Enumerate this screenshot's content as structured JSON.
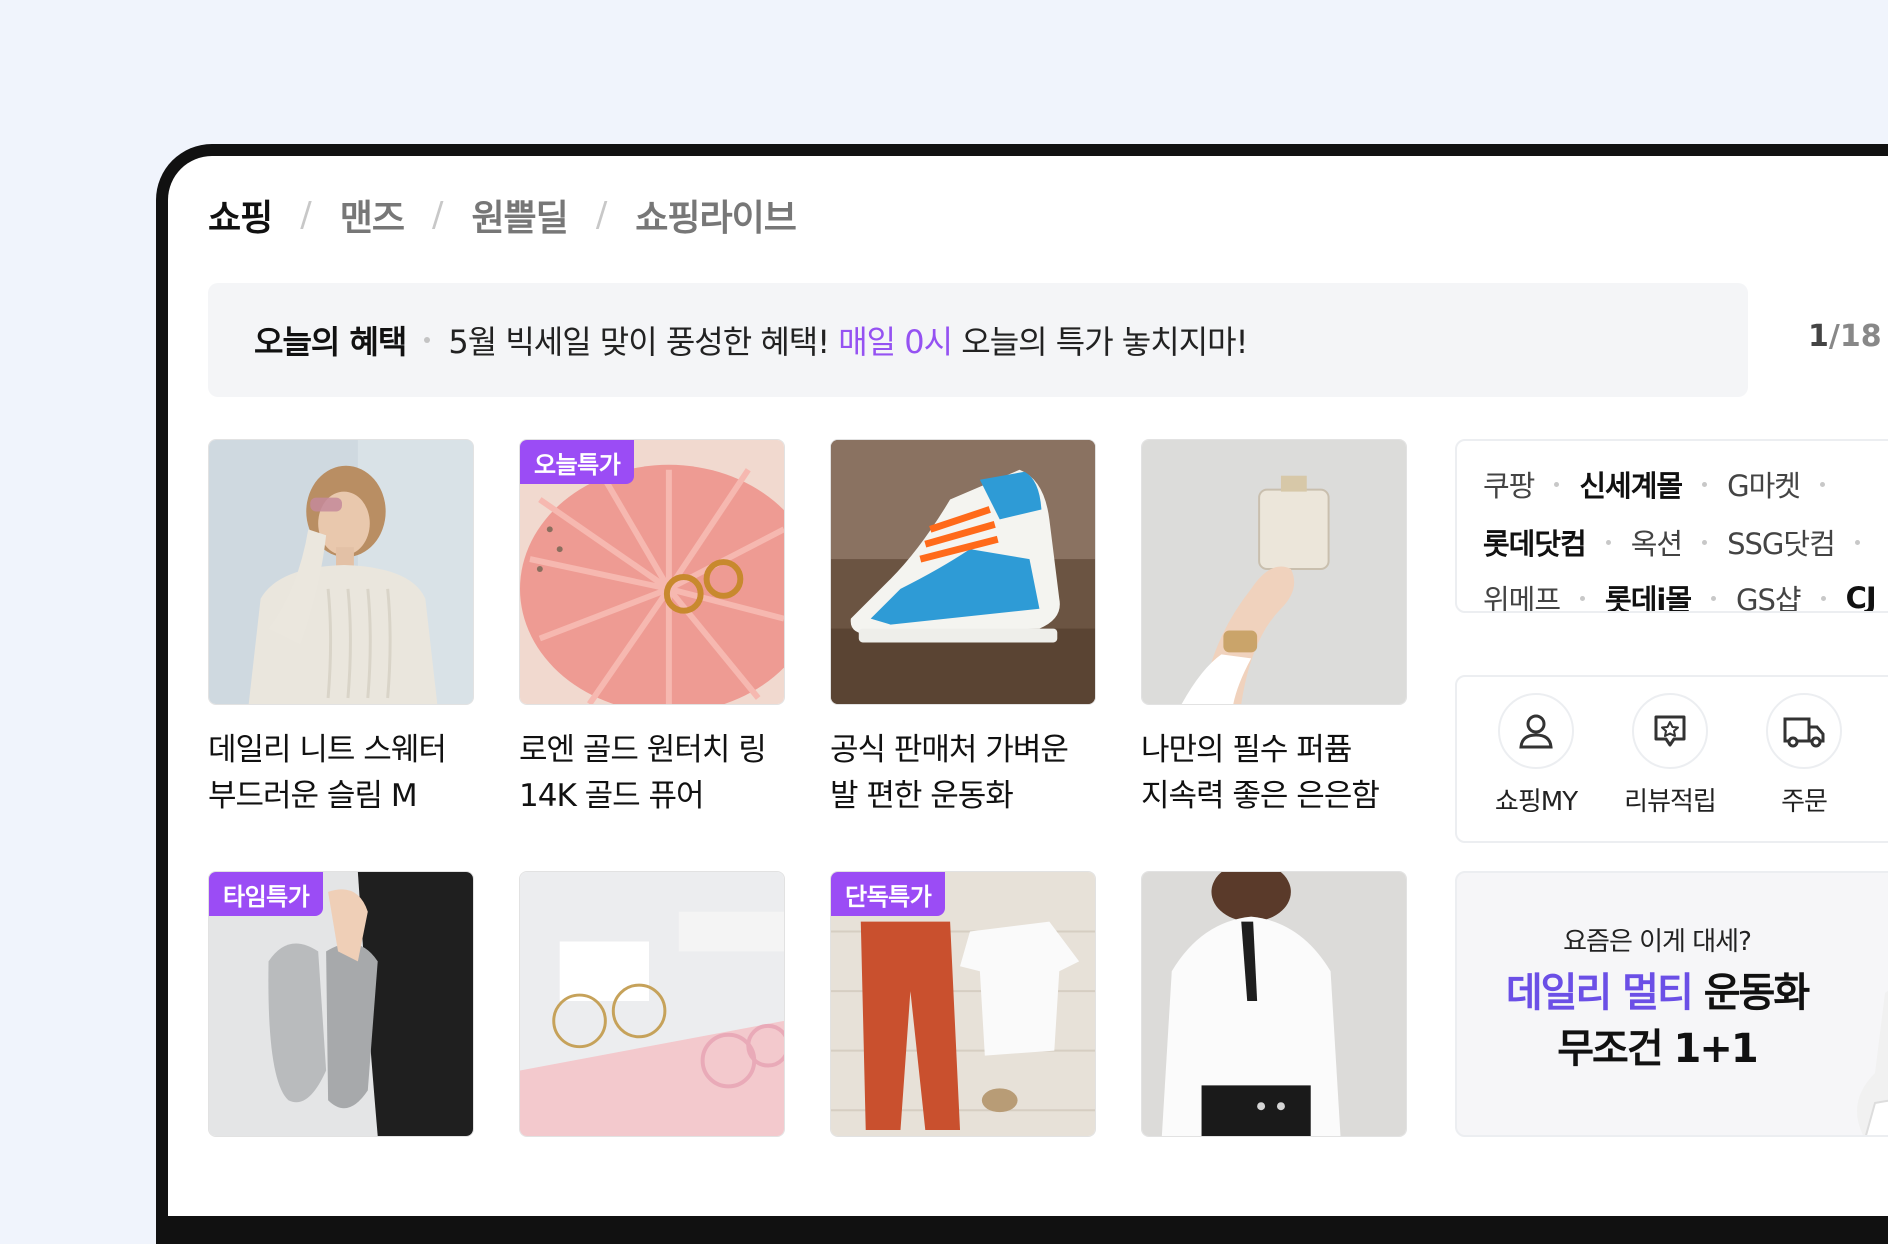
{
  "breadcrumb": [
    {
      "label": "쇼핑",
      "active": true
    },
    {
      "label": "맨즈",
      "active": false
    },
    {
      "label": "원쁠딜",
      "active": false
    },
    {
      "label": "쇼핑라이브",
      "active": false
    }
  ],
  "notice": {
    "title": "오늘의 혜택",
    "text_before": "5월 빅세일 맞이 풍성한 혜택! ",
    "highlight": "매일 0시",
    "text_after": " 오늘의 특가 놓치지마!",
    "highlight_color": "#9552f2"
  },
  "pager": {
    "current": "1",
    "total": "/18"
  },
  "products": [
    {
      "badge": "",
      "line1": "데일리 니트 스웨터",
      "line2": "부드러운 슬림 M"
    },
    {
      "badge": "오늘특가",
      "line1": "로엔 골드 원터치 링",
      "line2": "14K 골드 퓨어"
    },
    {
      "badge": "",
      "line1": "공식 판매처 가벼운",
      "line2": "발 편한 운동화"
    },
    {
      "badge": "",
      "line1": "나만의 필수 퍼퓸",
      "line2": "지속력 좋은 은은함"
    },
    {
      "badge": "타임특가"
    },
    {
      "badge": ""
    },
    {
      "badge": "단독특가"
    },
    {
      "badge": ""
    }
  ],
  "stores": {
    "row1": [
      {
        "label": "쿠팡",
        "bold": false
      },
      {
        "label": "신세계몰",
        "bold": true
      },
      {
        "label": "G마켓",
        "bold": false
      }
    ],
    "row2": [
      {
        "label": "롯데닷컴",
        "bold": true
      },
      {
        "label": "옥션",
        "bold": false
      },
      {
        "label": "SSG닷컴",
        "bold": false
      }
    ],
    "row3": [
      {
        "label": "위메프",
        "bold": false
      },
      {
        "label": "롯데i몰",
        "bold": true
      },
      {
        "label": "GS샵",
        "bold": false
      },
      {
        "label": "CJ",
        "bold": false
      }
    ]
  },
  "quick_menu": [
    {
      "label": "쇼핑MY",
      "icon": "person-icon"
    },
    {
      "label": "리뷰적립",
      "icon": "review-star-icon"
    },
    {
      "label": "주문",
      "icon": "delivery-truck-icon"
    }
  ],
  "promo": {
    "sub": "요즘은 이게 대세?",
    "highlight": "데일리 멀티",
    "main_rest": " 운동화",
    "line2": "무조건 1+1",
    "highlight_color": "#6b4fe6"
  },
  "colors": {
    "badge": "#9b4cf5",
    "page_background": "#f0f4fc",
    "frame": "#111111"
  }
}
